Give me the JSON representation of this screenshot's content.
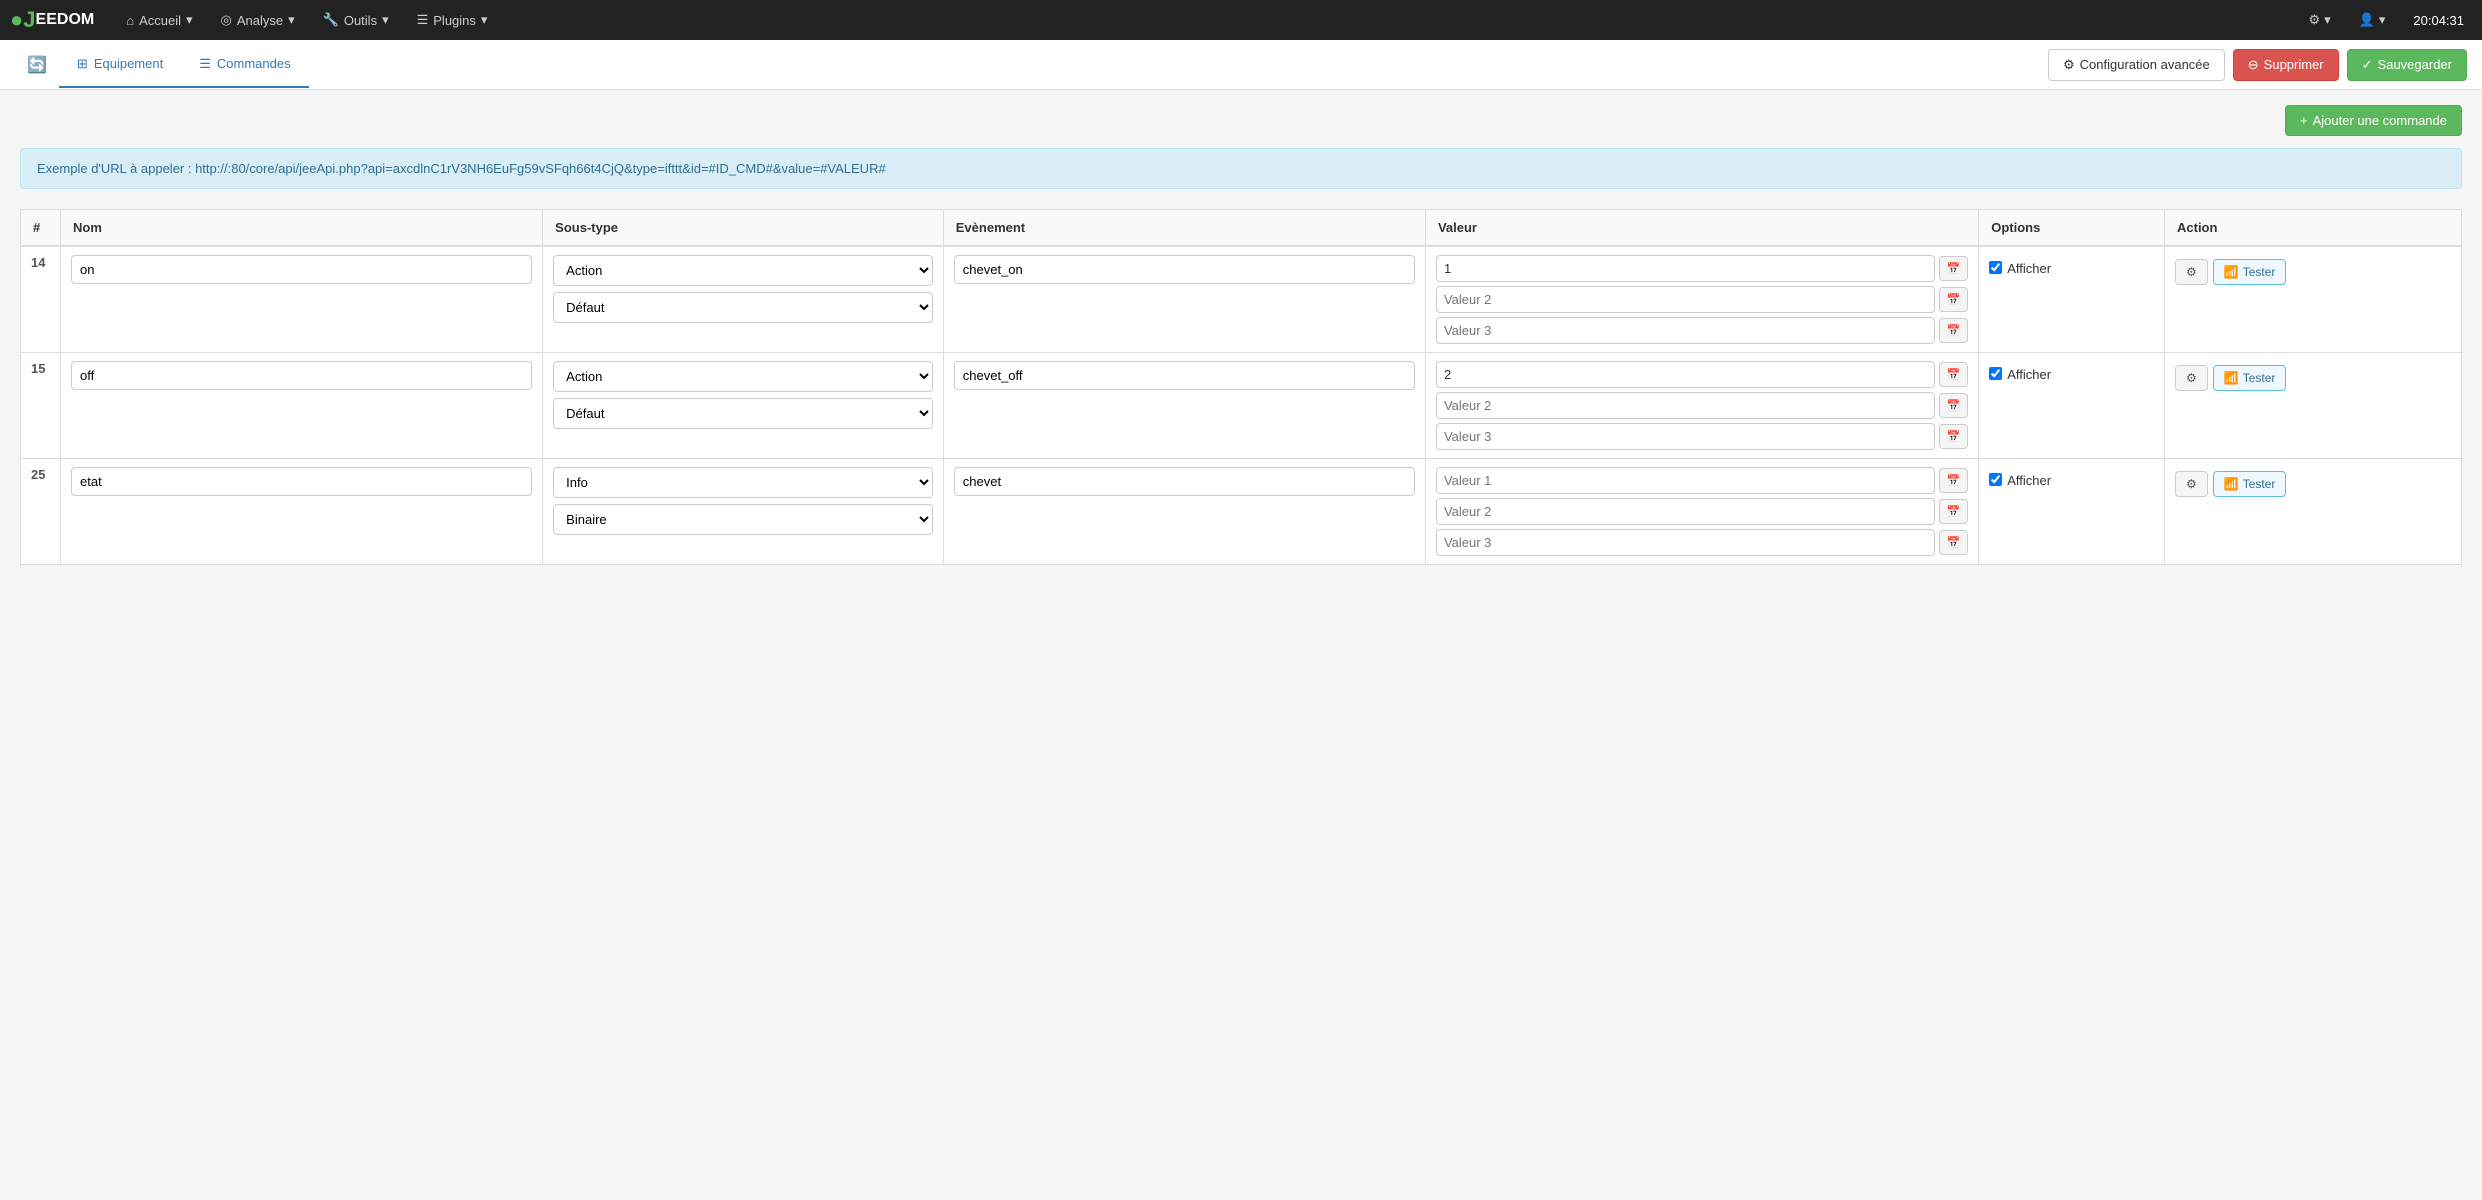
{
  "navbar": {
    "brand_j": "J",
    "brand_eedom": "EEDOM",
    "nav_items": [
      {
        "id": "accueil",
        "label": "Accueil",
        "icon": "home"
      },
      {
        "id": "analyse",
        "label": "Analyse",
        "icon": "analysis"
      },
      {
        "id": "outils",
        "label": "Outils",
        "icon": "tools"
      },
      {
        "id": "plugins",
        "label": "Plugins",
        "icon": "plugins"
      }
    ],
    "time": "20:04:31"
  },
  "tabs": {
    "back_icon": "←",
    "items": [
      {
        "id": "equipement",
        "label": "Equipement",
        "icon": "equip",
        "active": false
      },
      {
        "id": "commandes",
        "label": "Commandes",
        "icon": "cmd",
        "active": true
      }
    ],
    "buttons": {
      "config_avancee": "Configuration avancée",
      "supprimer": "Supprimer",
      "sauvegarder": "Sauvegarder"
    }
  },
  "main": {
    "add_command_label": "Ajouter une commande",
    "info_url": "Exemple d'URL à appeler : http://:80/core/api/jeeApi.php?api=axcdlnC1rV3NH6EuFg59vSFqh66t4CjQ&type=ifttt&id=#ID_CMD#&value=#VALEUR#",
    "table": {
      "headers": [
        "#",
        "Nom",
        "Sous-type",
        "Evènement",
        "Valeur",
        "Options",
        "Action"
      ],
      "rows": [
        {
          "num": "14",
          "nom": "on",
          "subtype1": "Action",
          "subtype2": "Défaut",
          "evenement": "chevet_on",
          "valeur1": "1",
          "valeur2": "Valeur 2",
          "valeur3": "Valeur 3",
          "afficher": true,
          "show_label": "Afficher"
        },
        {
          "num": "15",
          "nom": "off",
          "subtype1": "Action",
          "subtype2": "Défaut",
          "evenement": "chevet_off",
          "valeur1": "2",
          "valeur2": "Valeur 2",
          "valeur3": "Valeur 3",
          "afficher": true,
          "show_label": "Afficher"
        },
        {
          "num": "25",
          "nom": "etat",
          "subtype1": "Info",
          "subtype2": "Binaire",
          "evenement": "chevet",
          "valeur1": "Valeur 1",
          "valeur2": "Valeur 2",
          "valeur3": "Valeur 3",
          "afficher": true,
          "show_label": "Afficher"
        }
      ],
      "tester_label": "Tester"
    }
  }
}
